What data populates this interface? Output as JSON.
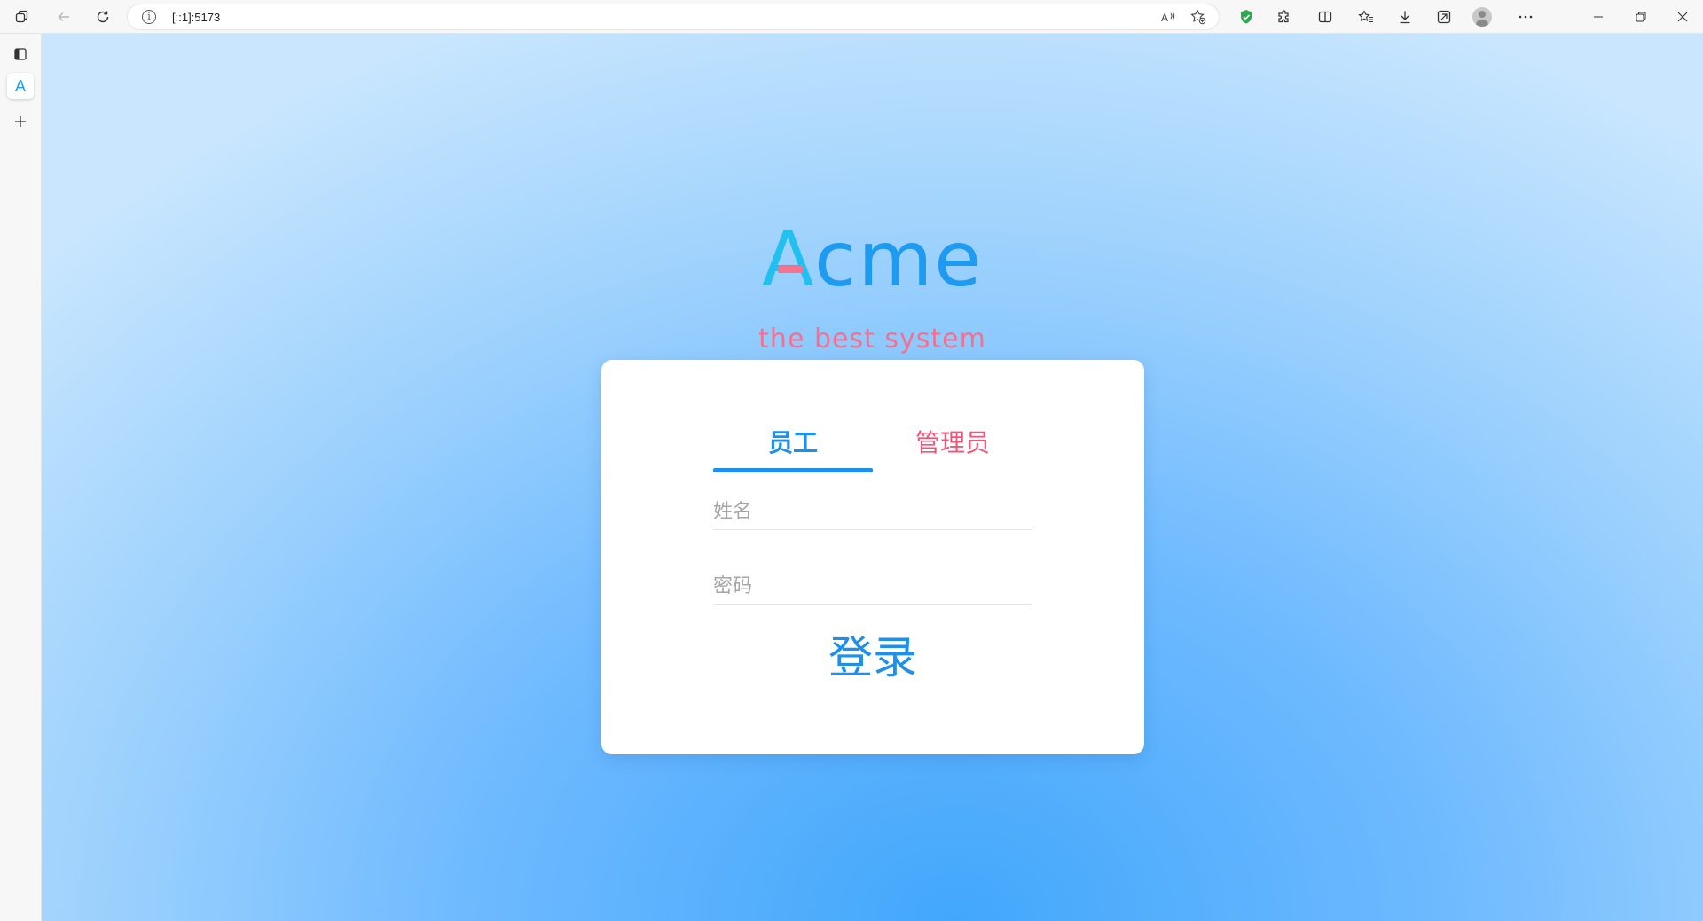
{
  "browser": {
    "url": "[::1]:5173"
  },
  "logo": {
    "first_letter": "A",
    "rest": "cme",
    "tagline": "the best system"
  },
  "login": {
    "tabs": [
      "员工",
      "管理员"
    ],
    "active_tab": "员工",
    "name_placeholder": "姓名",
    "name_value": "",
    "password_placeholder": "密码",
    "password_value": "",
    "submit_label": "登录"
  },
  "colors": {
    "primary": "#1e8fea",
    "accent_pink": "#f0567a",
    "logo_cyan": "#22bff1",
    "background_top": "#c9e6fe",
    "background_bottom": "#42a7fb"
  },
  "icons": {
    "toolbar_left": [
      "tab-actions-icon",
      "back-arrow-icon",
      "refresh-icon"
    ],
    "address_bar": [
      "site-info-icon",
      "read-aloud-icon",
      "add-favorite-icon"
    ],
    "toolbar_right": [
      "shield-extension-icon",
      "extensions-icon",
      "split-screen-icon",
      "favorites-icon",
      "downloads-icon",
      "screenshot-icon",
      "profile-avatar-icon",
      "more-options-icon"
    ],
    "window": [
      "minimize-icon",
      "restore-icon",
      "close-icon"
    ],
    "sidebar": [
      "vertical-tabs-icon",
      "app-tab-icon",
      "add-tab-icon"
    ]
  }
}
